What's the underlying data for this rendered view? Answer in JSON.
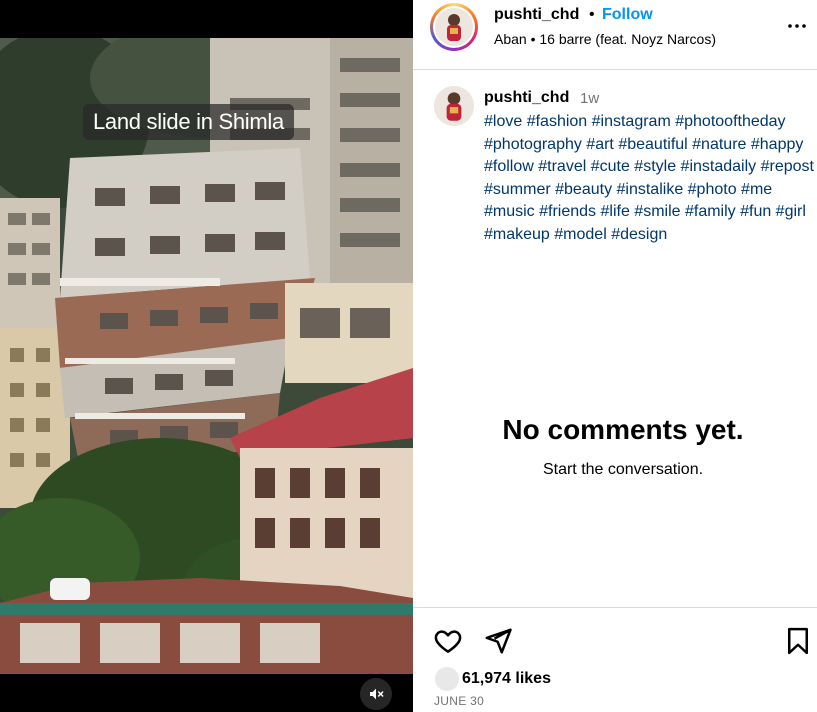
{
  "media": {
    "overlay_caption": "Land slide in Shimla",
    "mute_icon": "speaker-muted-icon"
  },
  "header": {
    "username": "pushti_chd",
    "separator": "•",
    "follow_label": "Follow",
    "audio": "Aban • 16 barre (feat. Noyz Narcos)",
    "more_icon": "more-horizontal-icon"
  },
  "caption": {
    "username": "pushti_chd",
    "time_ago": "1w",
    "hashtags": "#love #fashion #instagram #photooftheday #photography #art #beautiful #nature #happy #follow #travel #cute #style #instadaily #repost #summer #beauty #instalike #photo #me #music #friends #life #smile #family #fun #girl #makeup #model #design"
  },
  "comments": {
    "empty_title": "No comments yet.",
    "empty_subtitle": "Start the conversation."
  },
  "actions": {
    "like_icon": "heart-icon",
    "comment_icon": "comment-icon",
    "share_icon": "send-icon",
    "save_icon": "bookmark-icon",
    "likes": "61,974 likes",
    "date": "JUNE 30"
  },
  "colors": {
    "follow_blue": "#0095f6",
    "hashtag_blue": "#00376b",
    "muted_gray": "#737373",
    "divider": "#dbdbdb"
  }
}
